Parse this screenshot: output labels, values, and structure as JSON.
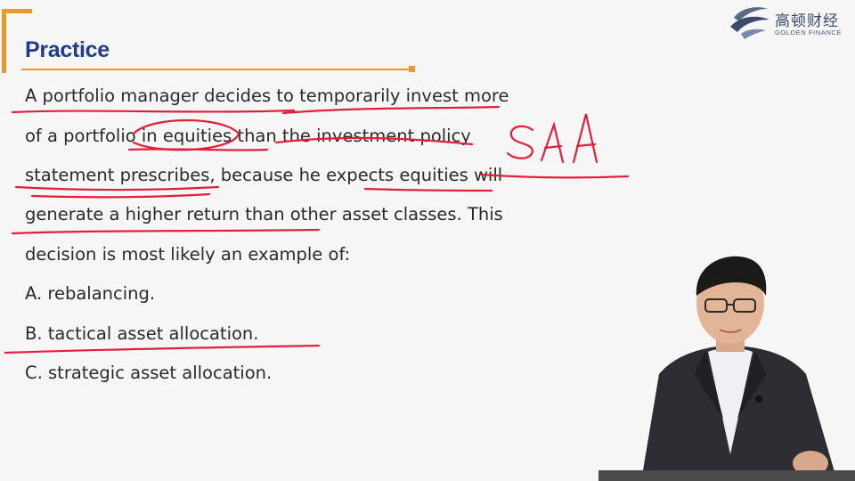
{
  "slide": {
    "title": "Practice",
    "logo": {
      "chinese_name": "高顿财经",
      "english_name": "GOLDEN FINANCE"
    },
    "question_lines": [
      "A portfolio manager decides to temporarily invest more",
      "of a portfolio in equities than the investment policy",
      "statement prescribes, because he expects equities will",
      "generate a higher return than other asset classes. This",
      "decision is most likely an example of:"
    ],
    "options": [
      "A. rebalancing.",
      "B. tactical asset allocation.",
      "C. strategic asset allocation."
    ],
    "handwritten_note": "SAA"
  },
  "colors": {
    "accent_orange": "#e89a2c",
    "title_blue": "#1f3d8a",
    "ink_red": "#e0203a",
    "background": "#f6f6f6"
  }
}
